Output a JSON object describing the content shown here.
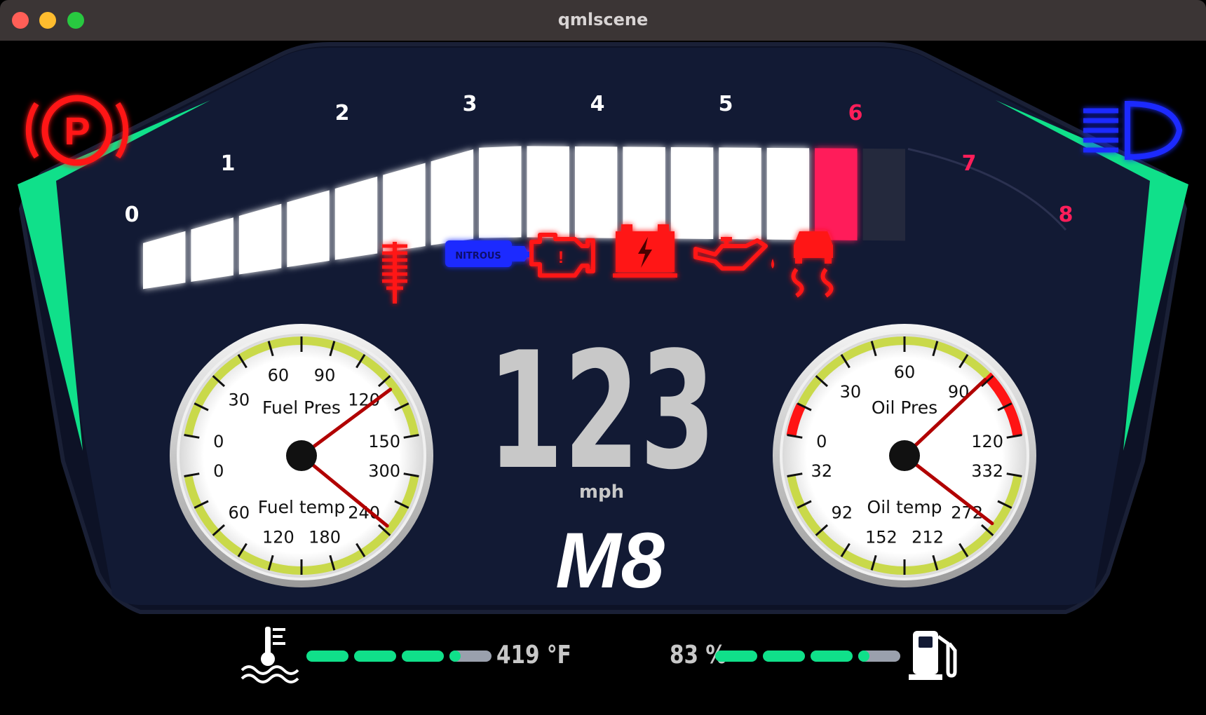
{
  "window": {
    "title": "qmlscene"
  },
  "tach": {
    "ticks": [
      "0",
      "1",
      "2",
      "3",
      "4",
      "5",
      "6",
      "7",
      "8"
    ],
    "redline_from": 6,
    "rpm_value": 6.3,
    "segments_lit": 14,
    "segments_red": 1
  },
  "speed": {
    "value": "123",
    "unit": "mph"
  },
  "gear": "M8",
  "left_gauge": {
    "top_label": "Fuel Pres",
    "top_ticks": [
      "0",
      "30",
      "60",
      "90",
      "120",
      "150"
    ],
    "top_value": 125,
    "bottom_label": "Fuel temp",
    "bottom_ticks": [
      "0",
      "60",
      "120",
      "180",
      "240",
      "300"
    ],
    "bottom_value": 245
  },
  "right_gauge": {
    "top_label": "Oil Pres",
    "top_ticks": [
      "0",
      "30",
      "60",
      "90",
      "120"
    ],
    "top_value": 95,
    "bottom_label": "Oil temp",
    "bottom_ticks": [
      "32",
      "92",
      "152",
      "212",
      "272",
      "332"
    ],
    "bottom_value": 280
  },
  "coolant": {
    "value": "419 °F",
    "bars_full": 3,
    "bar_partial": 0.2
  },
  "fuel": {
    "value": "83 %",
    "bars_full": 3,
    "bar_partial": 0.2
  },
  "indicators": {
    "parking_brake": "parking-brake-icon",
    "headlight": "high-beam-icon",
    "drag_tree": "drag-tree-icon",
    "nitrous": "nitrous-icon",
    "nitrous_text": "NITROUS",
    "check_engine": "check-engine-icon",
    "battery": "battery-icon",
    "oil": "oil-can-icon",
    "traction": "traction-control-icon",
    "colors": {
      "red": "#ff1414",
      "blue": "#1e2bff",
      "green": "#10e08a",
      "redline": "#ff1e5a"
    }
  }
}
